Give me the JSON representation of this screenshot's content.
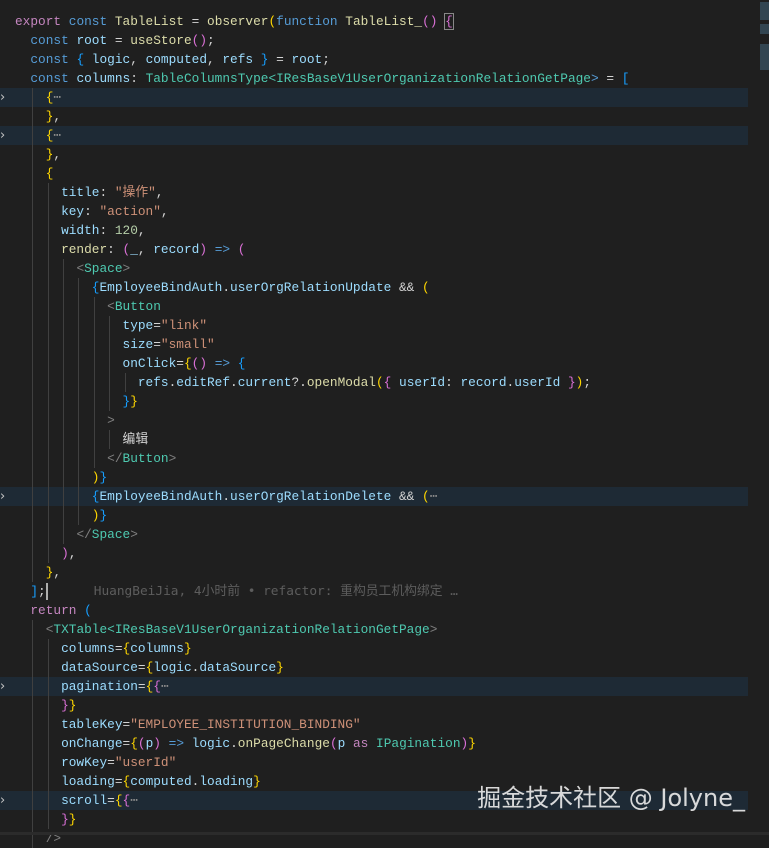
{
  "editor": {
    "lines": [
      {
        "i": 0,
        "t": [
          [
            "export ",
            "kp"
          ],
          [
            "const ",
            "k"
          ],
          [
            "TableList",
            "f"
          ],
          [
            " = ",
            "p"
          ],
          [
            "observer",
            "f"
          ],
          [
            "(",
            "b1"
          ],
          [
            "function ",
            "k"
          ],
          [
            "TableList_",
            "f"
          ],
          [
            "()",
            "b2"
          ],
          [
            " ",
            "p"
          ],
          [
            "{",
            "b2 box"
          ]
        ]
      },
      {
        "i": 1,
        "t": [
          [
            "const ",
            "k"
          ],
          [
            "root",
            "v"
          ],
          [
            " = ",
            "p"
          ],
          [
            "useStore",
            "f"
          ],
          [
            "()",
            "b2"
          ],
          [
            ";",
            "p"
          ]
        ]
      },
      {
        "i": 1,
        "t": [
          [
            "const ",
            "k"
          ],
          [
            "{ ",
            "b3"
          ],
          [
            "logic",
            "v"
          ],
          [
            ", ",
            "p"
          ],
          [
            "computed",
            "v"
          ],
          [
            ", ",
            "p"
          ],
          [
            "refs",
            "v"
          ],
          [
            " }",
            "b3"
          ],
          [
            " = ",
            "p"
          ],
          [
            "root",
            "v"
          ],
          [
            ";",
            "p"
          ]
        ]
      },
      {
        "i": 1,
        "t": [
          [
            "const ",
            "k"
          ],
          [
            "columns",
            "v"
          ],
          [
            ": ",
            "p"
          ],
          [
            "TableColumnsType",
            "ty"
          ],
          [
            "<",
            "ty"
          ],
          [
            "IResBaseV1UserOrganizationRelationGetPage",
            "ty"
          ],
          [
            ">",
            "k"
          ],
          [
            " = ",
            "p"
          ],
          [
            "[",
            "b3"
          ]
        ]
      },
      {
        "i": 2,
        "fold": true,
        "t": [
          [
            "{",
            "b1"
          ],
          [
            "⋯",
            "cm"
          ]
        ]
      },
      {
        "i": 2,
        "t": [
          [
            "}",
            "b1"
          ],
          [
            ",",
            "p"
          ]
        ]
      },
      {
        "i": 2,
        "fold": true,
        "t": [
          [
            "{",
            "b1"
          ],
          [
            "⋯",
            "cm"
          ]
        ]
      },
      {
        "i": 2,
        "t": [
          [
            "}",
            "b1"
          ],
          [
            ",",
            "p"
          ]
        ]
      },
      {
        "i": 2,
        "t": [
          [
            "{",
            "b1"
          ]
        ]
      },
      {
        "i": 3,
        "t": [
          [
            "title",
            "v"
          ],
          [
            ": ",
            "p"
          ],
          [
            "\"操作\"",
            "s"
          ],
          [
            ",",
            "p"
          ]
        ]
      },
      {
        "i": 3,
        "t": [
          [
            "key",
            "v"
          ],
          [
            ": ",
            "p"
          ],
          [
            "\"action\"",
            "s"
          ],
          [
            ",",
            "p"
          ]
        ]
      },
      {
        "i": 3,
        "t": [
          [
            "width",
            "v"
          ],
          [
            ": ",
            "p"
          ],
          [
            "120",
            "n"
          ],
          [
            ",",
            "p"
          ]
        ]
      },
      {
        "i": 3,
        "t": [
          [
            "render",
            "f"
          ],
          [
            ": ",
            "p"
          ],
          [
            "(",
            "b2"
          ],
          [
            "_",
            "v"
          ],
          [
            ", ",
            "p"
          ],
          [
            "record",
            "v"
          ],
          [
            ")",
            "b2"
          ],
          [
            " ",
            "p"
          ],
          [
            "=>",
            "k"
          ],
          [
            " ",
            "p"
          ],
          [
            "(",
            "b2"
          ]
        ]
      },
      {
        "i": 4,
        "t": [
          [
            "<",
            "tg"
          ],
          [
            "Space",
            "ty"
          ],
          [
            ">",
            "tg"
          ]
        ]
      },
      {
        "i": 5,
        "t": [
          [
            "{",
            "b3"
          ],
          [
            "EmployeeBindAuth",
            "v"
          ],
          [
            ".",
            "p"
          ],
          [
            "userOrgRelationUpdate",
            "v"
          ],
          [
            " && ",
            "p"
          ],
          [
            "(",
            "b1"
          ]
        ]
      },
      {
        "i": 6,
        "t": [
          [
            "<",
            "tg"
          ],
          [
            "Button",
            "ty"
          ]
        ]
      },
      {
        "i": 7,
        "t": [
          [
            "type",
            "v"
          ],
          [
            "=",
            "p"
          ],
          [
            "\"link\"",
            "s"
          ]
        ]
      },
      {
        "i": 7,
        "t": [
          [
            "size",
            "v"
          ],
          [
            "=",
            "p"
          ],
          [
            "\"small\"",
            "s"
          ]
        ]
      },
      {
        "i": 7,
        "t": [
          [
            "onClick",
            "v"
          ],
          [
            "=",
            "p"
          ],
          [
            "{",
            "b1"
          ],
          [
            "()",
            "b2"
          ],
          [
            " ",
            "p"
          ],
          [
            "=>",
            "k"
          ],
          [
            " ",
            "p"
          ],
          [
            "{",
            "b3"
          ]
        ]
      },
      {
        "i": 8,
        "t": [
          [
            "refs",
            "v"
          ],
          [
            ".",
            "p"
          ],
          [
            "editRef",
            "v"
          ],
          [
            ".",
            "p"
          ],
          [
            "current",
            "v"
          ],
          [
            "?.",
            "p"
          ],
          [
            "openModal",
            "f"
          ],
          [
            "(",
            "b1"
          ],
          [
            "{ ",
            "b2"
          ],
          [
            "userId",
            "v"
          ],
          [
            ": ",
            "p"
          ],
          [
            "record",
            "v"
          ],
          [
            ".",
            "p"
          ],
          [
            "userId",
            "v"
          ],
          [
            " }",
            "b2"
          ],
          [
            ")",
            "b1"
          ],
          [
            ";",
            "p"
          ]
        ]
      },
      {
        "i": 7,
        "t": [
          [
            "}",
            "b3"
          ],
          [
            "}",
            "b1"
          ]
        ]
      },
      {
        "i": 6,
        "t": [
          [
            ">",
            "tg"
          ]
        ]
      },
      {
        "i": 7,
        "t": [
          [
            "编辑",
            "zh"
          ]
        ]
      },
      {
        "i": 6,
        "t": [
          [
            "</",
            "tg"
          ],
          [
            "Button",
            "ty"
          ],
          [
            ">",
            "tg"
          ]
        ]
      },
      {
        "i": 5,
        "t": [
          [
            ")",
            "b1"
          ],
          [
            "}",
            "b3"
          ]
        ]
      },
      {
        "i": 5,
        "fold": true,
        "t": [
          [
            "{",
            "b3"
          ],
          [
            "EmployeeBindAuth",
            "v"
          ],
          [
            ".",
            "p"
          ],
          [
            "userOrgRelationDelete",
            "v"
          ],
          [
            " && ",
            "p"
          ],
          [
            "(",
            "b1"
          ],
          [
            "⋯",
            "cm"
          ]
        ]
      },
      {
        "i": 5,
        "t": [
          [
            ")",
            "b1"
          ],
          [
            "}",
            "b3"
          ]
        ]
      },
      {
        "i": 4,
        "t": [
          [
            "</",
            "tg"
          ],
          [
            "Space",
            "ty"
          ],
          [
            ">",
            "tg"
          ]
        ]
      },
      {
        "i": 3,
        "t": [
          [
            ")",
            "b2"
          ],
          [
            ",",
            "p"
          ]
        ]
      },
      {
        "i": 2,
        "t": [
          [
            "}",
            "b1"
          ],
          [
            ",",
            "p"
          ]
        ]
      },
      {
        "i": 1,
        "blame": "HuangBeiJia, 4小时前 • refactor: 重构员工机构绑定 …",
        "cursor": true,
        "t": [
          [
            "]",
            "b3"
          ],
          [
            ";",
            "p"
          ]
        ]
      },
      {
        "i": 1,
        "t": [
          [
            "return ",
            "kp"
          ],
          [
            "(",
            "b3"
          ]
        ]
      },
      {
        "i": 2,
        "t": [
          [
            "<",
            "tg"
          ],
          [
            "TXTable",
            "ty"
          ],
          [
            "<",
            "ty"
          ],
          [
            "IResBaseV1UserOrganizationRelationGetPage",
            "ty"
          ],
          [
            ">",
            "tg"
          ]
        ]
      },
      {
        "i": 3,
        "t": [
          [
            "columns",
            "v"
          ],
          [
            "=",
            "p"
          ],
          [
            "{",
            "b1"
          ],
          [
            "columns",
            "v"
          ],
          [
            "}",
            "b1"
          ]
        ]
      },
      {
        "i": 3,
        "t": [
          [
            "dataSource",
            "v"
          ],
          [
            "=",
            "p"
          ],
          [
            "{",
            "b1"
          ],
          [
            "logic",
            "v"
          ],
          [
            ".",
            "p"
          ],
          [
            "dataSource",
            "v"
          ],
          [
            "}",
            "b1"
          ]
        ]
      },
      {
        "i": 3,
        "fold": true,
        "t": [
          [
            "pagination",
            "v"
          ],
          [
            "=",
            "p"
          ],
          [
            "{",
            "b1"
          ],
          [
            "{",
            "b2"
          ],
          [
            "⋯",
            "cm"
          ]
        ]
      },
      {
        "i": 3,
        "t": [
          [
            "}",
            "b2"
          ],
          [
            "}",
            "b1"
          ]
        ]
      },
      {
        "i": 3,
        "t": [
          [
            "tableKey",
            "v"
          ],
          [
            "=",
            "p"
          ],
          [
            "\"EMPLOYEE_INSTITUTION_BINDING\"",
            "s"
          ]
        ]
      },
      {
        "i": 3,
        "t": [
          [
            "onChange",
            "v"
          ],
          [
            "=",
            "p"
          ],
          [
            "{",
            "b1"
          ],
          [
            "(",
            "b2"
          ],
          [
            "p",
            "v"
          ],
          [
            ")",
            "b2"
          ],
          [
            " ",
            "p"
          ],
          [
            "=>",
            "k"
          ],
          [
            " ",
            "p"
          ],
          [
            "logic",
            "v"
          ],
          [
            ".",
            "p"
          ],
          [
            "onPageChange",
            "f"
          ],
          [
            "(",
            "b2"
          ],
          [
            "p",
            "v"
          ],
          [
            " as ",
            "kp"
          ],
          [
            "IPagination",
            "ty"
          ],
          [
            ")",
            "b2"
          ],
          [
            "}",
            "b1"
          ]
        ]
      },
      {
        "i": 3,
        "t": [
          [
            "rowKey",
            "v"
          ],
          [
            "=",
            "p"
          ],
          [
            "\"userId\"",
            "s"
          ]
        ]
      },
      {
        "i": 3,
        "t": [
          [
            "loading",
            "v"
          ],
          [
            "=",
            "p"
          ],
          [
            "{",
            "b1"
          ],
          [
            "computed",
            "v"
          ],
          [
            ".",
            "p"
          ],
          [
            "loading",
            "v"
          ],
          [
            "}",
            "b1"
          ]
        ]
      },
      {
        "i": 3,
        "fold": true,
        "t": [
          [
            "scroll",
            "v"
          ],
          [
            "=",
            "p"
          ],
          [
            "{",
            "b1"
          ],
          [
            "{",
            "b2"
          ],
          [
            "⋯",
            "cm"
          ]
        ]
      },
      {
        "i": 3,
        "t": [
          [
            "}",
            "b2"
          ],
          [
            "}",
            "b1"
          ]
        ]
      },
      {
        "i": 2,
        "t": [
          [
            "/>",
            "tg"
          ]
        ]
      }
    ]
  },
  "watermark": "掘金技术社区 @ Jolyne_",
  "colors": {
    "background": "#1f1f1f",
    "fold_highlight": "#1e2a35"
  }
}
